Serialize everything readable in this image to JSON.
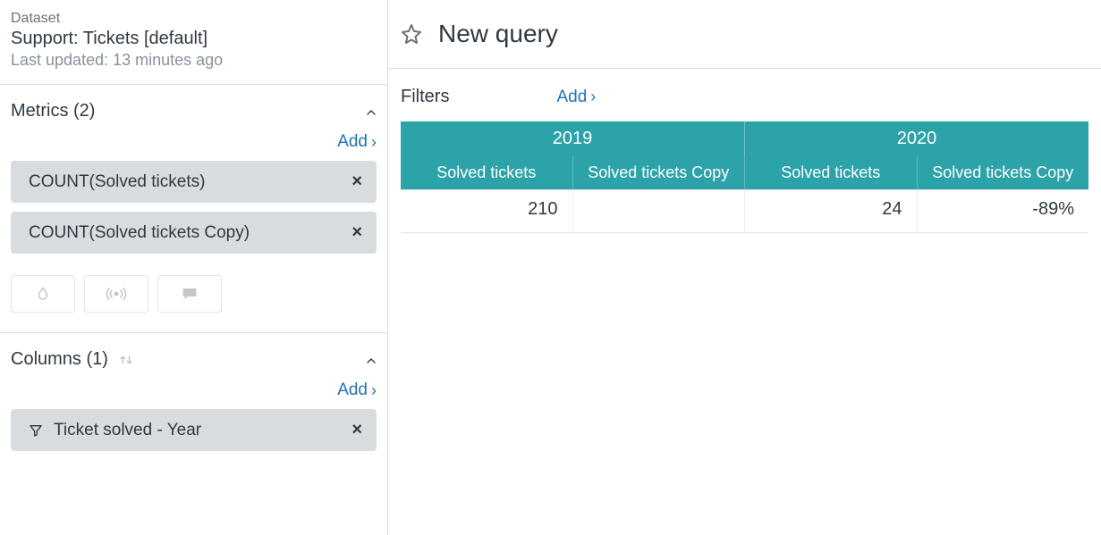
{
  "sidebar": {
    "dataset": {
      "label": "Dataset",
      "title": "Support: Tickets [default]",
      "updated": "Last updated: 13 minutes ago"
    },
    "metrics": {
      "header": "Metrics (2)",
      "add": "Add",
      "items": [
        {
          "label": "COUNT(Solved tickets)"
        },
        {
          "label": "COUNT(Solved tickets Copy)"
        }
      ]
    },
    "columns": {
      "header": "Columns (1)",
      "add": "Add",
      "items": [
        {
          "label": "Ticket solved - Year"
        }
      ]
    }
  },
  "main": {
    "title": "New query",
    "filters": {
      "label": "Filters",
      "add": "Add"
    }
  },
  "chart_data": {
    "type": "table",
    "columns_group": [
      "2019",
      "2020"
    ],
    "sub_columns": [
      "Solved tickets",
      "Solved tickets Copy"
    ],
    "rows": [
      {
        "2019": {
          "solved": "210",
          "copy": ""
        },
        "2020": {
          "solved": "24",
          "copy": "-89%"
        }
      }
    ]
  }
}
